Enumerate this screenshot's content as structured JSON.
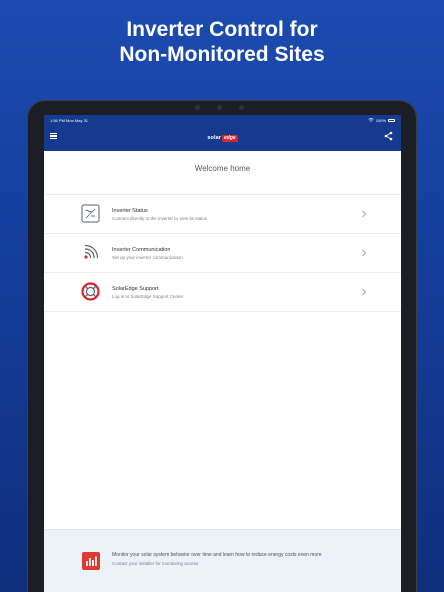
{
  "promo": {
    "title_line1": "Inverter Control for",
    "title_line2": "Non-Monitored Sites"
  },
  "status_bar": {
    "time_date": "1:56 PM  Mon May 31",
    "battery": "100%"
  },
  "app_bar": {
    "logo_solar": "solar",
    "logo_edge": "edge"
  },
  "welcome": "Welcome home",
  "menu": [
    {
      "icon": "inverter-icon",
      "title": "Inverter Status",
      "subtitle": "Connect directly to the inverter to view its status"
    },
    {
      "icon": "communication-icon",
      "title": "Inverter Communication",
      "subtitle": "Set up your inverter communication"
    },
    {
      "icon": "support-lifebuoy-icon",
      "title": "SolarEdge Support",
      "subtitle": "Log in to SolarEdge Support Center"
    }
  ],
  "banner": {
    "icon": "monitoring-chart-icon",
    "line1": "Monitor your solar system behavior over time and learn how to reduce energy costs even more",
    "line2": "Contact your installer for monitoring access"
  },
  "colors": {
    "brand_blue": "#163a8f",
    "brand_red": "#d8262b",
    "background_gradient_top": "#1c4bb0",
    "background_gradient_bottom": "#102f7d"
  }
}
